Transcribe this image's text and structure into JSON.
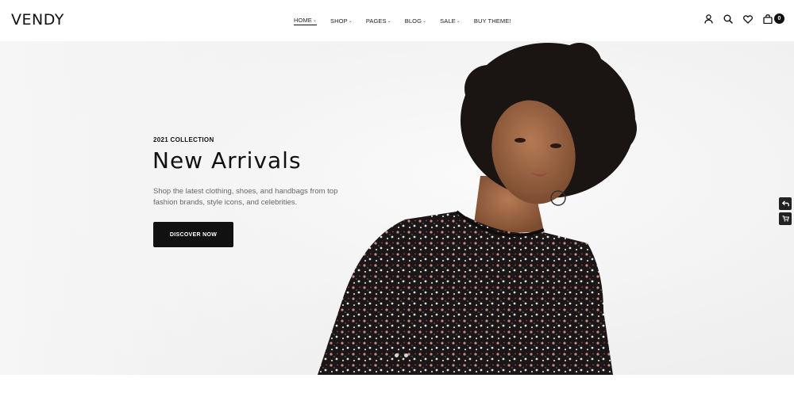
{
  "brand": {
    "logo": "VENDY"
  },
  "nav": {
    "items": [
      {
        "label": "HOME",
        "has_dropdown": true,
        "active": true
      },
      {
        "label": "SHOP",
        "has_dropdown": true
      },
      {
        "label": "PAGES",
        "has_dropdown": true
      },
      {
        "label": "BLOG",
        "has_dropdown": true
      },
      {
        "label": "SALE",
        "has_dropdown": true
      },
      {
        "label": "BUY THEME!",
        "has_dropdown": false
      }
    ],
    "chevron": "⌄"
  },
  "header_icons": {
    "account": "user-icon",
    "search": "search-icon",
    "wishlist": "heart-icon",
    "cart": "bag-icon",
    "cart_count": "0"
  },
  "hero": {
    "eyebrow": "2021 COLLECTION",
    "title": "New Arrivals",
    "description": "Shop the latest clothing, shoes, and handbags from top fashion brands, style icons, and celebrities.",
    "cta_label": "DISCOVER NOW",
    "slides": 3,
    "active_slide": 1
  },
  "side_buttons": [
    "back-arrow-icon",
    "cart-icon"
  ],
  "colors": {
    "accent": "#111111",
    "text_muted": "#666666",
    "dot": "#d8d8d8"
  }
}
